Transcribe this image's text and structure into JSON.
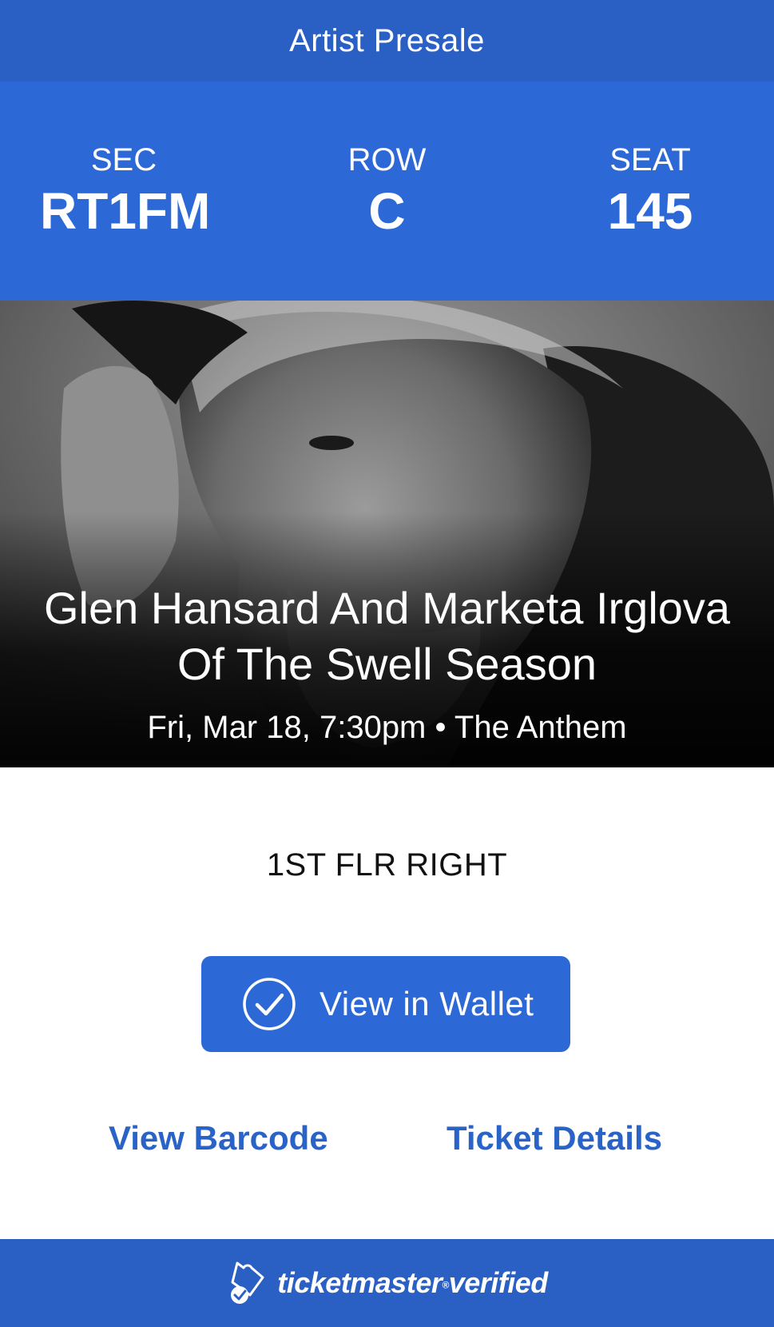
{
  "header": {
    "title": "Artist Presale"
  },
  "seating": {
    "section": {
      "label": "SEC",
      "value": "RT1FM"
    },
    "row": {
      "label": "ROW",
      "value": "C"
    },
    "seat": {
      "label": "SEAT",
      "value": "145"
    }
  },
  "event": {
    "title": "Glen Hansard And Marketa Irglova Of The Swell Season",
    "datetime": "Fri, Mar 18, 7:30pm",
    "separator": "•",
    "venue": "The Anthem"
  },
  "level": "1ST FLR RIGHT",
  "actions": {
    "wallet_label": "View in Wallet",
    "barcode_label": "View Barcode",
    "details_label": "Ticket Details"
  },
  "footer": {
    "brand": "ticketmaster",
    "brand_suffix": "verified",
    "brand_reg": "®"
  },
  "colors": {
    "primary": "#2d69d6",
    "header": "#2a5fc3",
    "link": "#2a63c8"
  },
  "icons": {
    "wallet": "check-circle-icon",
    "footer": "ticket-check-icon"
  }
}
